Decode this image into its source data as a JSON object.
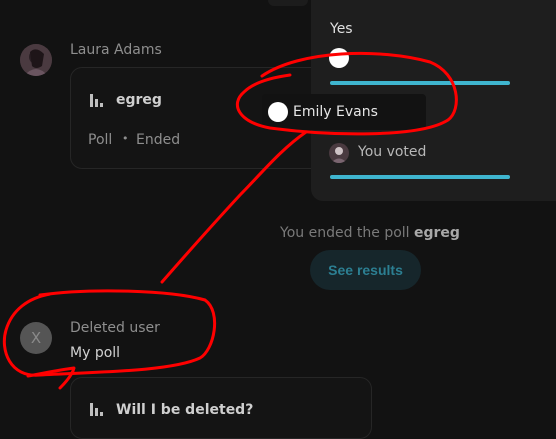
{
  "messages": [
    {
      "author": "Laura Adams",
      "poll": {
        "title": "egreg",
        "meta_type": "Poll",
        "meta_sep": "•",
        "meta_status": "Ended"
      }
    },
    {
      "author": "Deleted user",
      "avatar_initial": "X",
      "text": "My poll",
      "poll": {
        "title": "Will I be deleted?"
      }
    }
  ],
  "popup": {
    "option_label": "Yes",
    "tooltip_name": "Emily Evans",
    "voted_label": "You voted",
    "accent": "#3fb5cf"
  },
  "notice": {
    "prefix": "You ended the poll ",
    "poll_name": "egreg"
  },
  "see_results_label": "See results",
  "annotation_color": "#ff0000"
}
